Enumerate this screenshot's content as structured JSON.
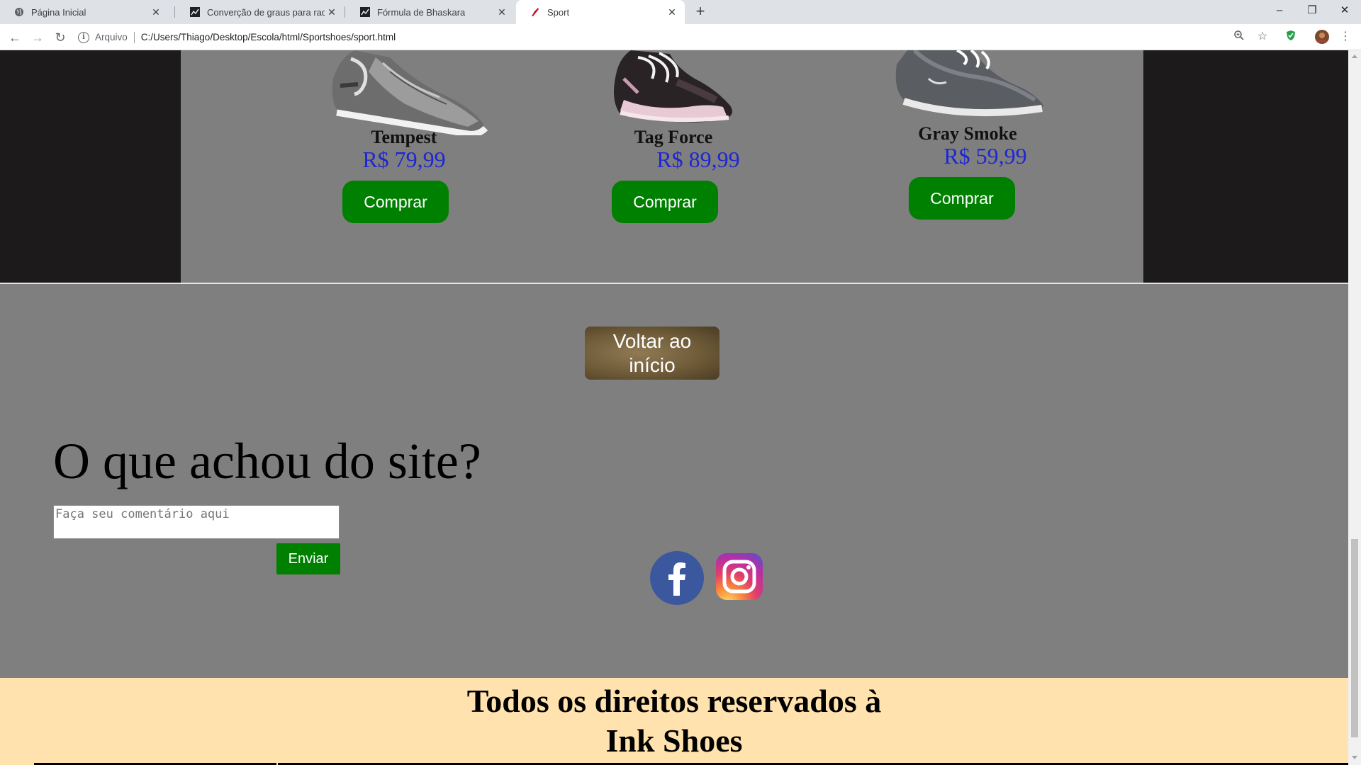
{
  "browser": {
    "tabs": [
      {
        "label": "Página Inicial",
        "icon": "globe-icon",
        "active": false
      },
      {
        "label": "Converção de graus para radiano",
        "icon": "chart-favicon-icon",
        "active": false
      },
      {
        "label": "Fórmula de Bhaskara",
        "icon": "chart-favicon-icon",
        "active": false
      },
      {
        "label": "Sport",
        "icon": "shoe-favicon-icon",
        "active": true
      }
    ],
    "new_tab": "+",
    "window_controls": {
      "minimize": "–",
      "restore": "❐",
      "close": "✕"
    },
    "toolbar": {
      "back": "←",
      "forward": "→",
      "reload": "↻",
      "scheme_label": "Arquivo",
      "url": "C:/Users/Thiago/Desktop/Escola/html/Sportshoes/sport.html",
      "icons": [
        "zoom-icon",
        "bookmark-star-icon",
        "extension-shield-icon",
        "profile-avatar-icon",
        "menu-dots-icon"
      ]
    }
  },
  "products": [
    {
      "name": "Tempest",
      "price": "R$ 79,99",
      "button": "Comprar"
    },
    {
      "name": "Tag Force",
      "price": "R$ 89,99",
      "button": "Comprar"
    },
    {
      "name": "Gray Smoke",
      "price": "R$ 59,99",
      "button": "Comprar"
    }
  ],
  "back_button": "Voltar ao início",
  "feedback": {
    "title": "O que achou do site?",
    "placeholder": "Faça seu comentário aqui",
    "send": "Enviar"
  },
  "social": {
    "icons": [
      "facebook-icon",
      "instagram-icon"
    ]
  },
  "footer": {
    "line1": "Todos os direitos reservados à",
    "line2": "Ink Shoes"
  },
  "colors": {
    "button_green": "#008000",
    "price_blue": "#1d27d2",
    "page_gray": "#7f7f7f",
    "side_dark": "#1c1a1b",
    "footer_bg": "#ffe2ad"
  }
}
